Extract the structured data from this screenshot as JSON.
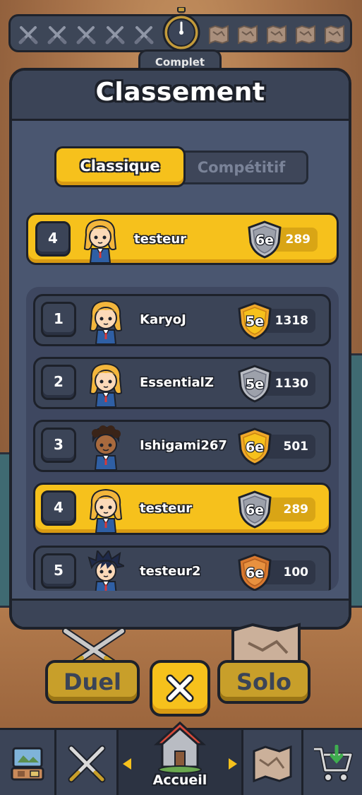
{
  "top_bar": {
    "completion_label": "Complet",
    "icons": [
      "crossed-swords-icon",
      "crossed-swords-icon",
      "crossed-swords-icon",
      "crossed-swords-icon",
      "crossed-swords-icon",
      "stopwatch-icon",
      "map-icon",
      "map-icon",
      "map-icon",
      "map-icon",
      "map-icon"
    ]
  },
  "modal": {
    "title": "Classement",
    "tabs": [
      {
        "label": "Classique",
        "active": true
      },
      {
        "label": "Compétitif",
        "active": false
      }
    ],
    "current_player": {
      "rank": "4",
      "name": "testeur",
      "badge": "6e",
      "badge_color": "silver",
      "score": "289"
    },
    "leaderboard": [
      {
        "rank": "1",
        "name": "KaryoJ",
        "badge": "5e",
        "badge_color": "gold",
        "score": "1318",
        "avatar": "blonde-girl",
        "highlight": false
      },
      {
        "rank": "2",
        "name": "EssentialZ",
        "badge": "5e",
        "badge_color": "silver",
        "score": "1130",
        "avatar": "blonde-girl",
        "highlight": false
      },
      {
        "rank": "3",
        "name": "Ishigami267",
        "badge": "6e",
        "badge_color": "gold",
        "score": "501",
        "avatar": "curly-boy",
        "highlight": false
      },
      {
        "rank": "4",
        "name": "testeur",
        "badge": "6e",
        "badge_color": "silver",
        "score": "289",
        "avatar": "blonde-girl",
        "highlight": true
      },
      {
        "rank": "5",
        "name": "testeur2",
        "badge": "6e",
        "badge_color": "bronze",
        "score": "100",
        "avatar": "spiky-boy",
        "highlight": false
      }
    ]
  },
  "actions": {
    "duel_label": "Duel",
    "solo_label": "Solo",
    "close_icon": "close-icon"
  },
  "bottom_nav": {
    "items": [
      {
        "icon": "shop-stall-icon"
      },
      {
        "icon": "crossed-swords-icon"
      },
      {
        "icon": "home-icon",
        "label": "Accueil"
      },
      {
        "icon": "map-icon"
      },
      {
        "icon": "cart-icon"
      }
    ]
  },
  "colors": {
    "accent_yellow": "#f6c11c",
    "panel": "#4a5670",
    "panel_dark": "#3b4457",
    "outline": "#1d212a",
    "badge_gold": "#f0a82a",
    "badge_silver": "#b9bcc3",
    "badge_bronze": "#d9792f"
  }
}
